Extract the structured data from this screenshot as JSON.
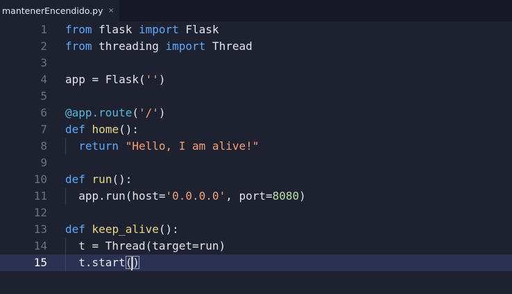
{
  "tab": {
    "filename": "mantenerEncendido.py",
    "close_glyph": "×"
  },
  "editor": {
    "current_line": 15,
    "lines": [
      {
        "n": "1",
        "tokens": [
          {
            "t": "kw",
            "v": "from"
          },
          {
            "t": "op",
            "v": " flask "
          },
          {
            "t": "kw",
            "v": "import"
          },
          {
            "t": "op",
            "v": " Flask"
          }
        ]
      },
      {
        "n": "2",
        "tokens": [
          {
            "t": "kw",
            "v": "from"
          },
          {
            "t": "op",
            "v": " threading "
          },
          {
            "t": "kw",
            "v": "import"
          },
          {
            "t": "op",
            "v": " Thread"
          }
        ]
      },
      {
        "n": "3",
        "tokens": []
      },
      {
        "n": "4",
        "tokens": [
          {
            "t": "op",
            "v": "app = Flask("
          },
          {
            "t": "str",
            "v": "''"
          },
          {
            "t": "op",
            "v": ")"
          }
        ]
      },
      {
        "n": "5",
        "tokens": []
      },
      {
        "n": "6",
        "tokens": [
          {
            "t": "dec",
            "v": "@app.route"
          },
          {
            "t": "op",
            "v": "("
          },
          {
            "t": "str",
            "v": "'/'"
          },
          {
            "t": "op",
            "v": ")"
          }
        ]
      },
      {
        "n": "7",
        "tokens": [
          {
            "t": "kw",
            "v": "def"
          },
          {
            "t": "op",
            "v": " "
          },
          {
            "t": "fn",
            "v": "home"
          },
          {
            "t": "op",
            "v": "():"
          }
        ]
      },
      {
        "n": "8",
        "indent": true,
        "tokens": [
          {
            "t": "kw",
            "v": "return"
          },
          {
            "t": "op",
            "v": " "
          },
          {
            "t": "str",
            "v": "\"Hello, I am alive!\""
          }
        ]
      },
      {
        "n": "9",
        "tokens": []
      },
      {
        "n": "10",
        "tokens": [
          {
            "t": "kw",
            "v": "def"
          },
          {
            "t": "op",
            "v": " "
          },
          {
            "t": "fn",
            "v": "run"
          },
          {
            "t": "op",
            "v": "():"
          }
        ]
      },
      {
        "n": "11",
        "indent": true,
        "tokens": [
          {
            "t": "op",
            "v": "app.run(host="
          },
          {
            "t": "str",
            "v": "'0.0.0.0'"
          },
          {
            "t": "op",
            "v": ", port="
          },
          {
            "t": "num",
            "v": "8080"
          },
          {
            "t": "op",
            "v": ")"
          }
        ]
      },
      {
        "n": "12",
        "tokens": []
      },
      {
        "n": "13",
        "tokens": [
          {
            "t": "kw",
            "v": "def"
          },
          {
            "t": "op",
            "v": " "
          },
          {
            "t": "fn",
            "v": "keep_alive"
          },
          {
            "t": "op",
            "v": "():"
          }
        ]
      },
      {
        "n": "14",
        "indent": true,
        "tokens": [
          {
            "t": "op",
            "v": "t = Thread(target=run)"
          }
        ]
      },
      {
        "n": "15",
        "indent": true,
        "tokens": [
          {
            "t": "op",
            "v": "t.start"
          },
          {
            "t": "bracket",
            "v": "("
          },
          {
            "t": "caret",
            "v": ""
          },
          {
            "t": "bracket",
            "v": ")"
          }
        ]
      }
    ]
  },
  "colors": {
    "keyword": "#5fa9ff",
    "function": "#e8d98a",
    "string": "#f2a27a",
    "number": "#b7e0a6",
    "decorator": "#58b9d8",
    "current_line_bg": "#2a3152"
  }
}
